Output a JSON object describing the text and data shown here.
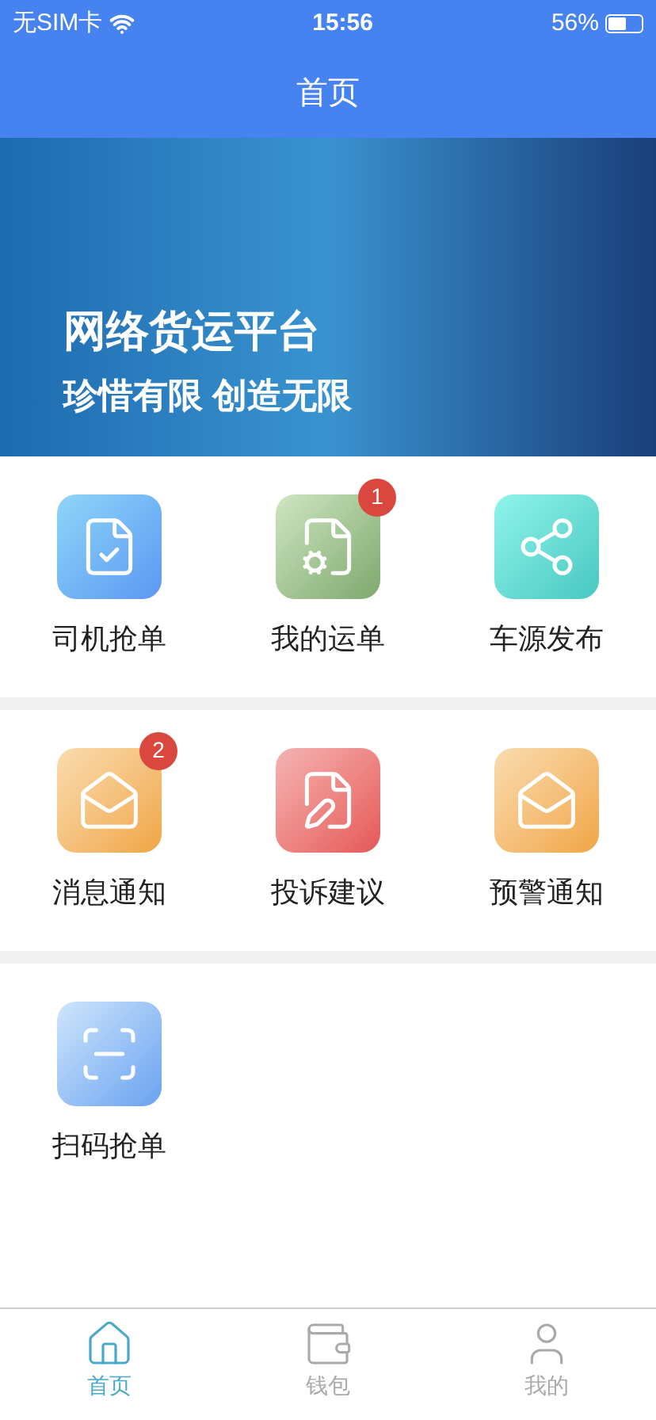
{
  "status_bar": {
    "carrier": "无SIM卡",
    "time": "15:56",
    "battery": "56%"
  },
  "header": {
    "title": "首页"
  },
  "banner": {
    "title": "网络货运平台",
    "subtitle": "珍惜有限 创造无限"
  },
  "sections": [
    {
      "items": [
        {
          "kind": "driver",
          "label": "司机抢单"
        },
        {
          "kind": "orders",
          "label": "我的运单",
          "badge": "1"
        },
        {
          "kind": "share",
          "label": "车源发布"
        }
      ]
    },
    {
      "items": [
        {
          "kind": "message",
          "label": "消息通知",
          "badge": "2"
        },
        {
          "kind": "complaint",
          "label": "投诉建议"
        },
        {
          "kind": "warning",
          "label": "预警通知"
        }
      ]
    },
    {
      "items": [
        {
          "kind": "scan",
          "label": "扫码抢单"
        }
      ]
    }
  ],
  "tabs": [
    {
      "kind": "home",
      "label": "首页",
      "selected": true
    },
    {
      "kind": "wallet",
      "label": "钱包",
      "selected": false
    },
    {
      "kind": "profile",
      "label": "我的",
      "selected": false
    }
  ]
}
